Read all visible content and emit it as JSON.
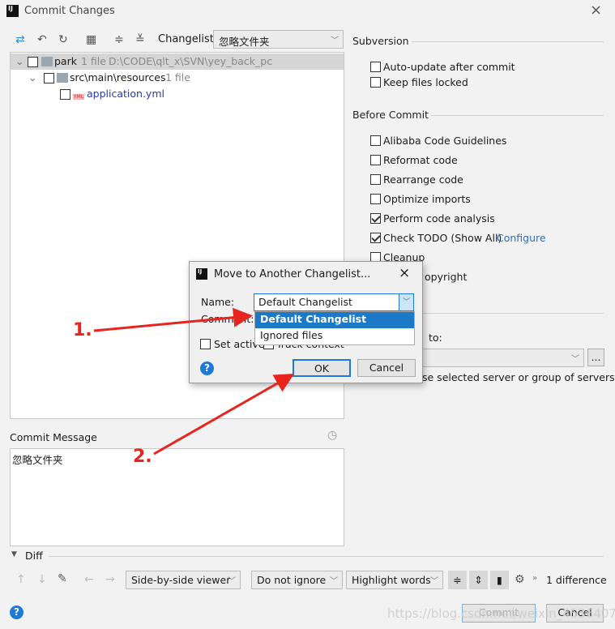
{
  "window": {
    "title": "Commit Changes",
    "close": "×"
  },
  "toolbar": {
    "changelist_label": "Changelist:",
    "changelist_value": "忽略文件夹"
  },
  "tree": [
    {
      "name": "park",
      "count": "1 file",
      "path": "D:\\CODE\\qlt_x\\SVN\\yey_back_pc"
    },
    {
      "name": "src\\main\\resources",
      "count": "1 file"
    },
    {
      "name": "application.yml",
      "badge": "YML"
    }
  ],
  "subversion": {
    "title": "Subversion",
    "options": [
      {
        "label": "Auto-update after commit",
        "checked": false
      },
      {
        "label": "Keep files locked",
        "checked": false
      }
    ]
  },
  "before_commit": {
    "title": "Before Commit",
    "options": [
      {
        "label": "Alibaba Code Guidelines",
        "checked": false
      },
      {
        "label": "Reformat code",
        "checked": false
      },
      {
        "label": "Rearrange code",
        "checked": false
      },
      {
        "label": "Optimize imports",
        "checked": false
      },
      {
        "label": "Perform code analysis",
        "checked": true
      },
      {
        "label": "Check TODO (Show All)",
        "checked": true,
        "link": "Configure"
      },
      {
        "label": "Cleanup",
        "checked": false
      },
      {
        "label": "opyright",
        "checked": false
      }
    ]
  },
  "after_commit": {
    "label_partial": "to:",
    "more": "...",
    "hint_partial": "se selected server or group of servers"
  },
  "commit_message": {
    "label": "Commit Message",
    "value": "忽略文件夹"
  },
  "diff": {
    "title": "Diff",
    "viewer": "Side-by-side viewer",
    "ignore": "Do not ignore",
    "highlight": "Highlight words",
    "count": "1 difference"
  },
  "footer": {
    "commit": "Commit",
    "cancel": "Cancel",
    "help": "?",
    "watermark": "https://blog.csdn.net/weixin_45364074"
  },
  "dialog": {
    "title": "Move to Another Changelist...",
    "name_label": "Name:",
    "name_value": "Default Changelist",
    "comment_label": "Comment:",
    "set_active": "Set active",
    "track_context": "Track context",
    "ok": "OK",
    "cancel": "Cancel",
    "help": "?",
    "options": [
      "Default Changelist",
      "Ignored files"
    ]
  },
  "annotations": {
    "step1": "1.",
    "step2": "2.",
    "color": "#e8241f"
  }
}
